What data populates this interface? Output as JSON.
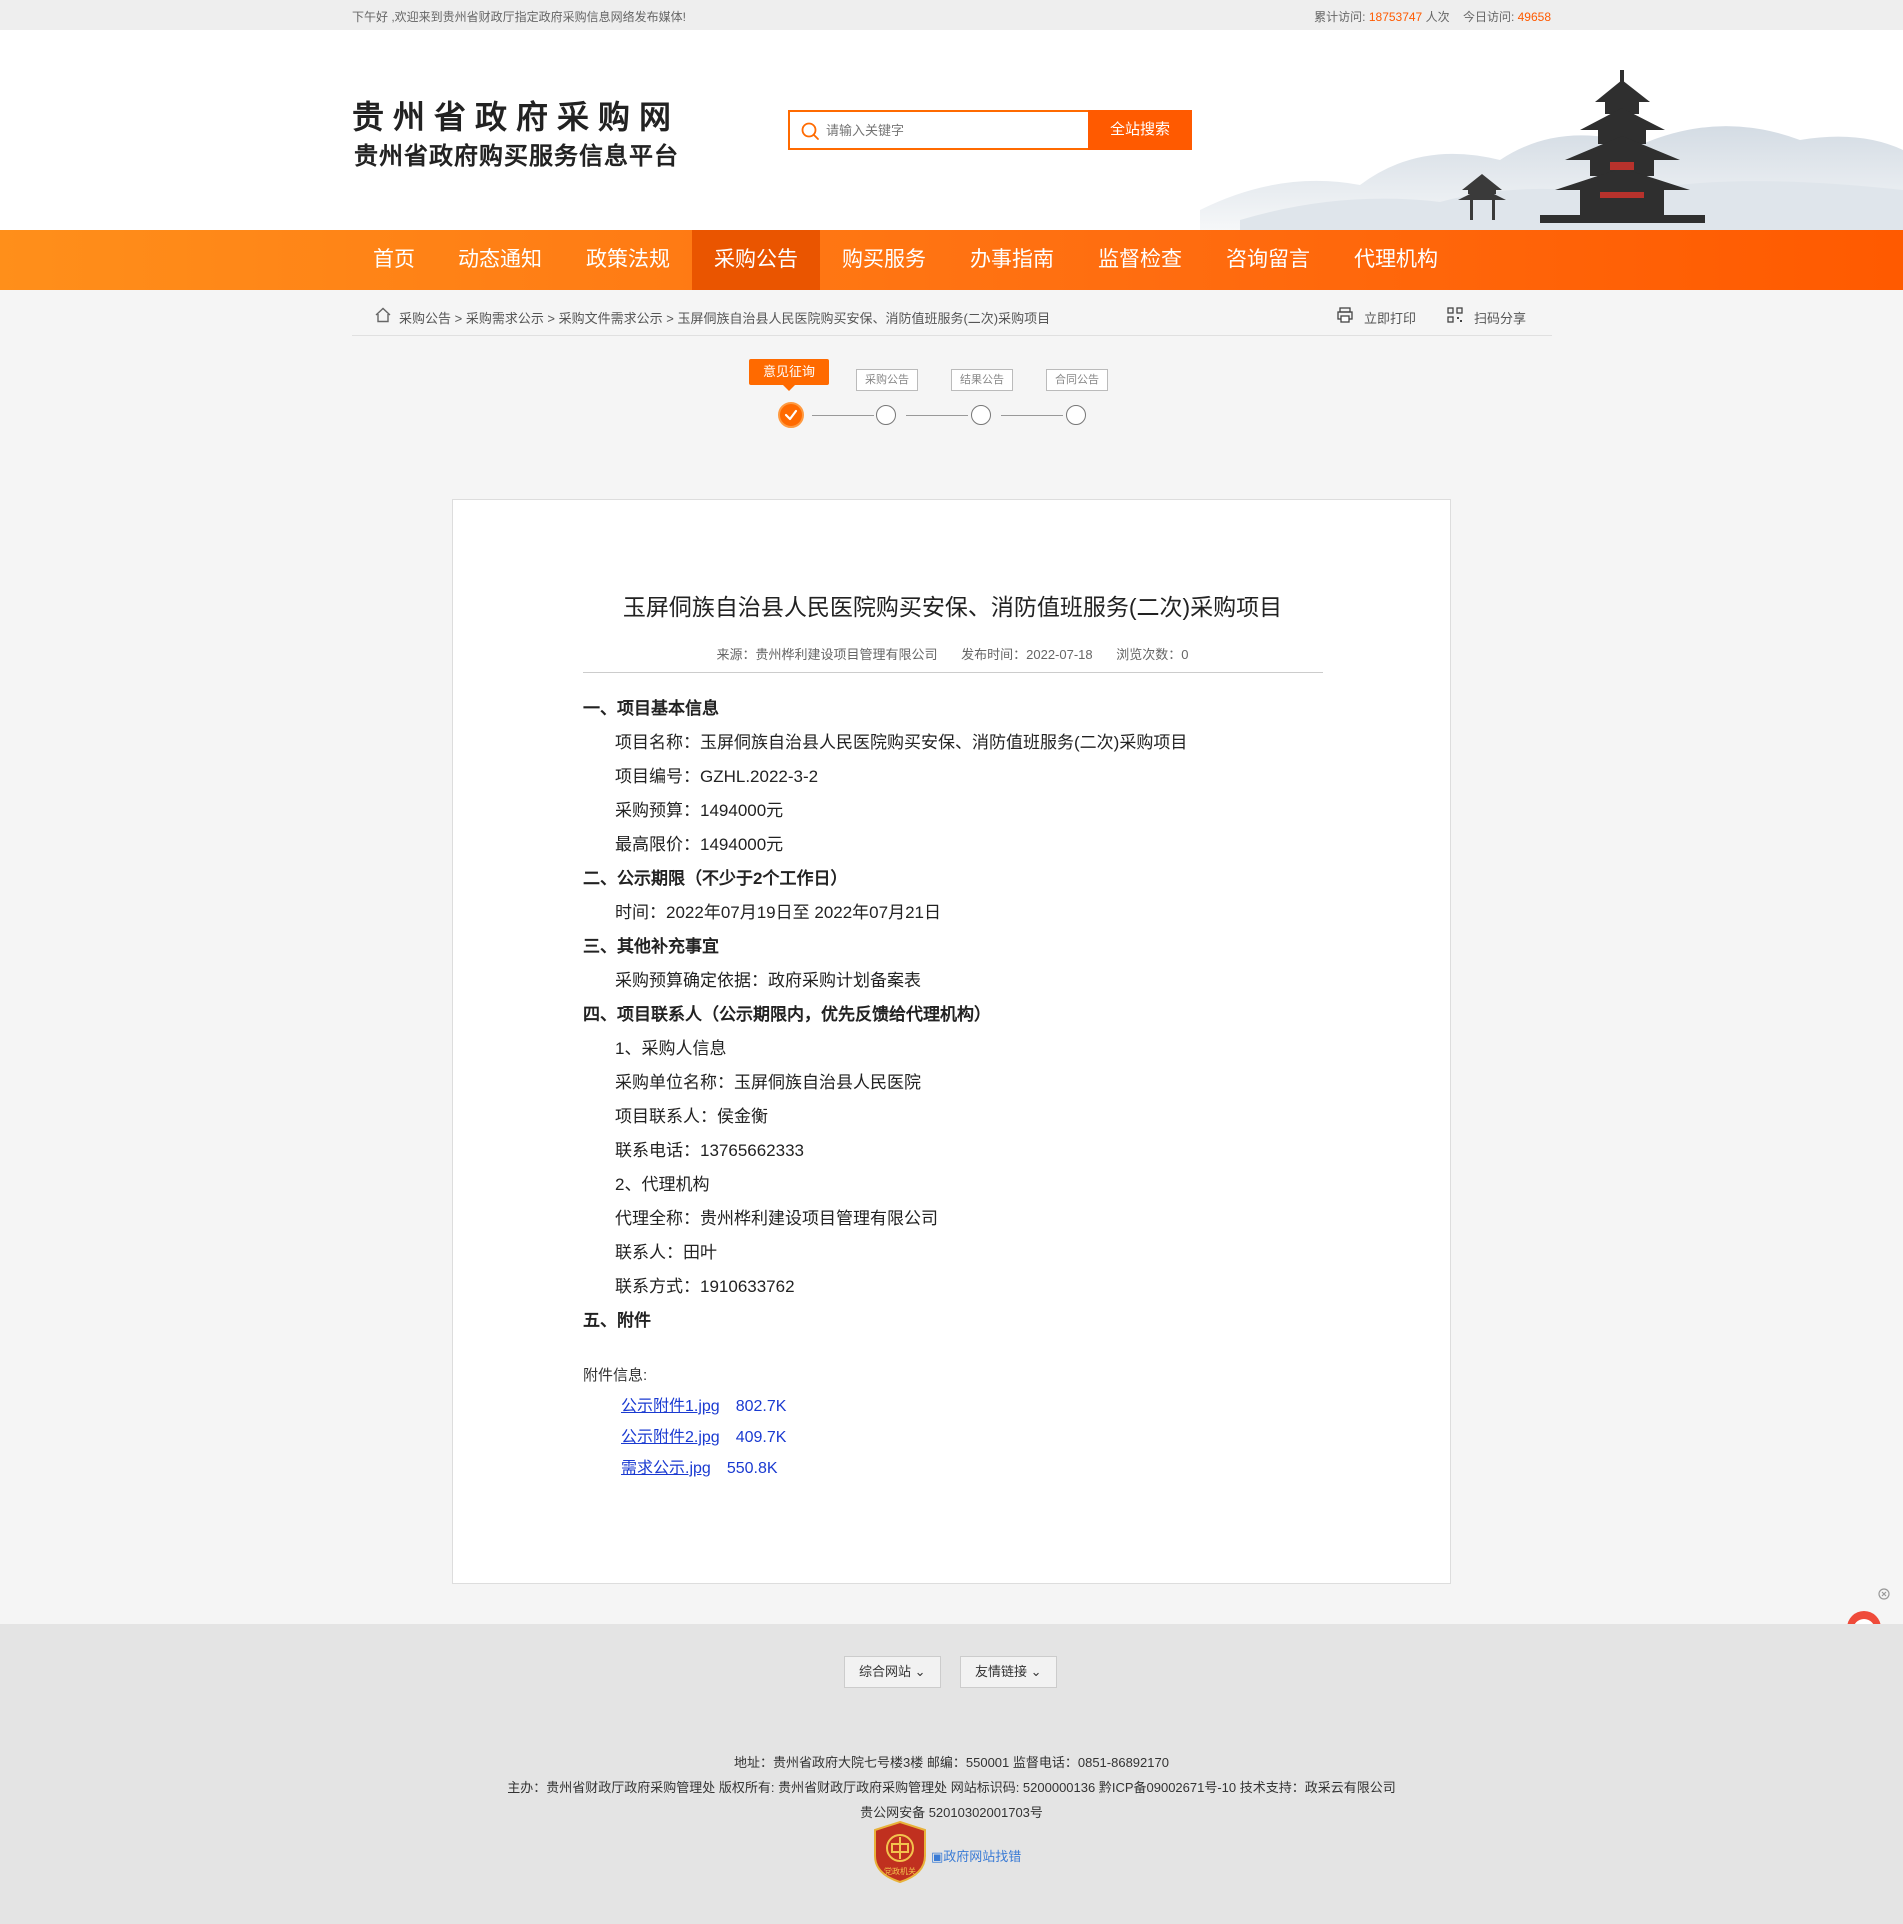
{
  "topbar": {
    "welcome": "下午好 ,欢迎来到贵州省财政厅指定政府采购信息网络发布媒体!",
    "total_label": "累计访问:",
    "total_value": "18753747",
    "total_unit": "人次",
    "today_label": "今日访问:",
    "today_value": "49658"
  },
  "header": {
    "logo_line1": "贵州省政府采购网",
    "logo_line2": "贵州省政府购买服务信息平台",
    "search_placeholder": "请输入关键字",
    "search_button": "全站搜索"
  },
  "nav": {
    "items": [
      "首页",
      "动态通知",
      "政策法规",
      "采购公告",
      "购买服务",
      "办事指南",
      "监督检查",
      "咨询留言",
      "代理机构"
    ],
    "active": "采购公告"
  },
  "breadcrumb": {
    "path": "采购公告 > 采购需求公示 > 采购文件需求公示 > 玉屏侗族自治县人民医院购买安保、消防值班服务(二次)采购项目",
    "print": "立即打印",
    "share": "扫码分享"
  },
  "steps": [
    "意见征询",
    "采购公告",
    "结果公告",
    "合同公告"
  ],
  "article": {
    "title": "玉屏侗族自治县人民医院购买安保、消防值班服务(二次)采购项目",
    "source": "来源：贵州桦利建设项目管理有限公司",
    "date": "发布时间：2022-07-18",
    "views": "浏览次数：0",
    "lines": [
      {
        "t": "h",
        "v": "一、项目基本信息"
      },
      {
        "t": "p",
        "v": "项目名称：玉屏侗族自治县人民医院购买安保、消防值班服务(二次)采购项目"
      },
      {
        "t": "p",
        "v": "项目编号：GZHL.2022-3-2"
      },
      {
        "t": "p",
        "v": "采购预算：1494000元"
      },
      {
        "t": "p",
        "v": "最高限价：1494000元"
      },
      {
        "t": "h",
        "v": "二、公示期限（不少于2个工作日）"
      },
      {
        "t": "p",
        "v": "时间：2022年07月19日至 2022年07月21日"
      },
      {
        "t": "h",
        "v": "三、其他补充事宜"
      },
      {
        "t": "p",
        "v": "采购预算确定依据：政府采购计划备案表"
      },
      {
        "t": "h",
        "v": "四、项目联系人（公示期限内，优先反馈给代理机构）"
      },
      {
        "t": "p",
        "v": "1、采购人信息"
      },
      {
        "t": "p",
        "v": "采购单位名称：玉屏侗族自治县人民医院"
      },
      {
        "t": "p",
        "v": "项目联系人：侯金衡"
      },
      {
        "t": "p",
        "v": "联系电话：13765662333"
      },
      {
        "t": "p",
        "v": "2、代理机构"
      },
      {
        "t": "p",
        "v": "代理全称：贵州桦利建设项目管理有限公司"
      },
      {
        "t": "p",
        "v": "联系人：田叶"
      },
      {
        "t": "p",
        "v": "联系方式：1910633762"
      },
      {
        "t": "h",
        "v": "五、附件"
      }
    ],
    "attachments_label": "附件信息:",
    "attachments": [
      {
        "name": "公示附件1.jpg",
        "size": "802.7K"
      },
      {
        "name": "公示附件2.jpg",
        "size": "409.7K"
      },
      {
        "name": "需求公示.jpg",
        "size": "550.8K"
      }
    ]
  },
  "footer": {
    "select1": "综合网站",
    "select2": "友情链接",
    "line1": "地址：贵州省政府大院七号楼3楼    邮编：550001    监督电话：0851-86892170",
    "line2": "主办：贵州省财政厅政府采购管理处    版权所有: 贵州省财政厅政府采购管理处    网站标识码: 5200000136    黔ICP备09002671号-10    技术支持：政采云有限公司",
    "line3": "贵公网安备 52010302001703号",
    "emblem_text": "党政机关",
    "broken_image_alt": "政府网站找错"
  },
  "colors": {
    "accent": "#ff6a00",
    "nav_active": "#ea5500",
    "link": "#1a3ad1"
  }
}
